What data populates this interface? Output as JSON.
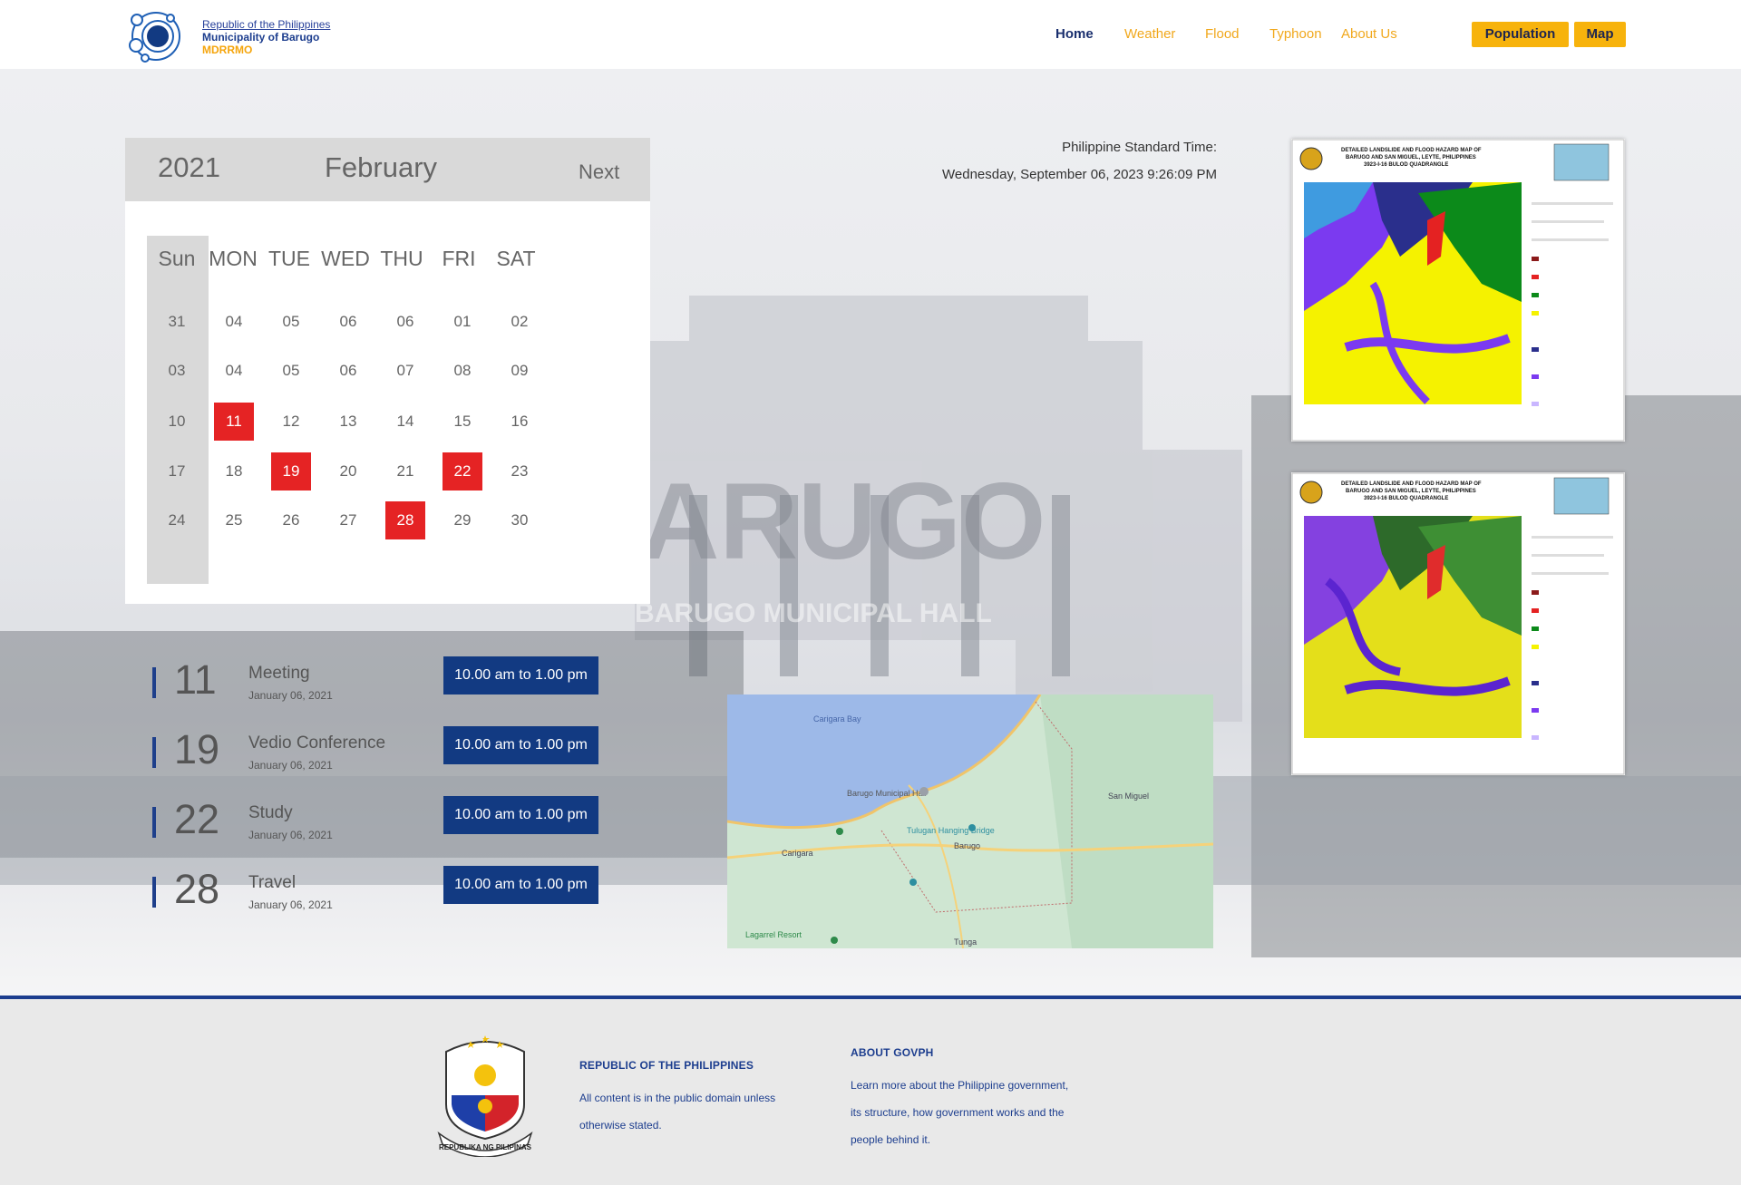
{
  "header": {
    "brand": {
      "line1": "Republic of the Philippines",
      "line2": "Municipality of Barugo",
      "line3": "MDRRMO"
    },
    "nav": {
      "home": "Home",
      "weather": "Weather",
      "flood": "Flood",
      "typhoon": "Typhoon",
      "about": "About Us"
    },
    "buttons": {
      "population": "Population",
      "map": "Map"
    },
    "background_watermark": "BARUGO",
    "background_watermark_sub": "BARUGO MUNICIPAL HALL"
  },
  "calendar": {
    "year": "2021",
    "month": "February",
    "next_label": "Next",
    "weekdays": [
      "Sun",
      "MON",
      "TUE",
      "WED",
      "THU",
      "FRI",
      "SAT"
    ],
    "weeks": [
      [
        "31",
        "04",
        "05",
        "06",
        "06",
        "01",
        "02"
      ],
      [
        "03",
        "04",
        "05",
        "06",
        "07",
        "08",
        "09"
      ],
      [
        "10",
        "11",
        "12",
        "13",
        "14",
        "15",
        "16"
      ],
      [
        "17",
        "18",
        "19",
        "20",
        "21",
        "22",
        "23"
      ],
      [
        "24",
        "25",
        "26",
        "27",
        "28",
        "29",
        "30"
      ]
    ],
    "highlighted_days": [
      "11",
      "19",
      "22",
      "28"
    ],
    "highlight_color": "#e52324"
  },
  "events": [
    {
      "day": "11",
      "title": "Meeting",
      "date": "January 06, 2021",
      "time": "10.00 am to 1.00 pm"
    },
    {
      "day": "19",
      "title": "Vedio Conference",
      "date": "January 06, 2021",
      "time": "10.00 am to 1.00 pm"
    },
    {
      "day": "22",
      "title": "Study",
      "date": "January 06, 2021",
      "time": "10.00 am to 1.00 pm"
    },
    {
      "day": "28",
      "title": "Travel",
      "date": "January 06, 2021",
      "time": "10.00 am to 1.00 pm"
    }
  ],
  "clock": {
    "label": "Philippine Standard Time:",
    "value": "Wednesday, September 06, 2023 9:26:09 PM"
  },
  "hazard_maps": [
    {
      "title_line1": "DETAILED LANDSLIDE AND FLOOD HAZARD MAP OF",
      "title_line2": "BARUGO AND SAN MIGUEL, LEYTE, PHILIPPINES",
      "title_line3": "3923-I-16 BULOD QUADRANGLE"
    },
    {
      "title_line1": "DETAILED LANDSLIDE AND FLOOD HAZARD MAP OF",
      "title_line2": "BARUGO AND SAN MIGUEL, LEYTE, PHILIPPINES",
      "title_line3": "3923-I-16 BULOD QUADRANGLE"
    }
  ],
  "location_map": {
    "labels": {
      "bay": "Carigara Bay",
      "barugo": "Barugo",
      "san_miguel": "San Miguel",
      "carigara": "Carigara",
      "tunga": "Tunga",
      "bridge": "Tulugan Hanging Bridge",
      "municipal": "Barugo Municipal Hall",
      "lagarrel": "Lagarrel Resort"
    }
  },
  "footer": {
    "col1_heading": "REPUBLIC OF THE PHILIPPINES",
    "col1_text_1": "All content is in the public domain unless",
    "col1_text_2": "otherwise stated.",
    "col2_heading": "ABOUT GOVPH",
    "col2_text_1": "Learn more about the Philippine government,",
    "col2_text_2": "its structure, how government works and the",
    "col2_text_3": "people behind it.",
    "seal_text": "REPUBLIKA NG PILIPINAS"
  },
  "colors": {
    "brand_blue": "#1c3d8e",
    "accent_yellow": "#f7b30c",
    "nav_orange": "#f1a81c",
    "event_button": "#123a82"
  }
}
